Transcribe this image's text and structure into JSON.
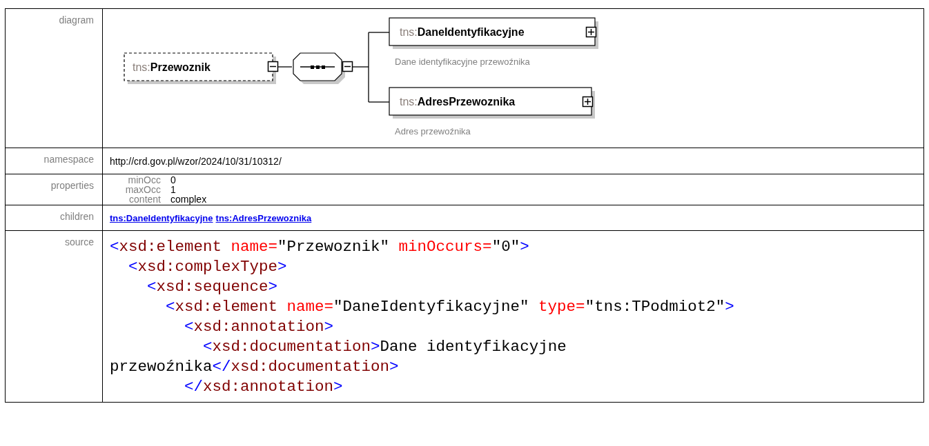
{
  "rows": [
    {
      "kind": "diagram",
      "label": "diagram",
      "diagram": {
        "root": {
          "prefix": "tns:",
          "name": "Przewoznik",
          "optional": true,
          "expanded": true
        },
        "compositor": {
          "kind": "sequence",
          "expanded": true
        },
        "children": [
          {
            "prefix": "tns:",
            "name": "DaneIdentyfikacyjne",
            "expanded": false,
            "annotation": "Dane identyfikacyjne przewoźnika"
          },
          {
            "prefix": "tns:",
            "name": "AdresPrzewoznika",
            "expanded": false,
            "annotation": "Adres przewoźnika"
          }
        ]
      }
    },
    {
      "kind": "text",
      "label": "namespace",
      "value": "http://crd.gov.pl/wzor/2024/10/31/10312/"
    },
    {
      "kind": "properties",
      "label": "properties",
      "items": [
        {
          "key": "minOcc",
          "value": "0"
        },
        {
          "key": "maxOcc",
          "value": "1"
        },
        {
          "key": "content",
          "value": "complex"
        }
      ]
    },
    {
      "kind": "links",
      "label": "children",
      "links": [
        "tns:DaneIdentyfikacyjne",
        "tns:AdresPrzewoznika"
      ]
    },
    {
      "kind": "source",
      "label": "source",
      "lines": [
        [
          {
            "kind": "tag",
            "t": "<"
          },
          {
            "kind": "element",
            "t": "xsd:element"
          },
          {
            "kind": "attribute",
            "t": " name="
          },
          {
            "kind": "text",
            "t": "\"Przewoznik\""
          },
          {
            "kind": "attribute",
            "t": " minOccurs="
          },
          {
            "kind": "text",
            "t": "\"0\""
          },
          {
            "kind": "tag",
            "t": ">"
          }
        ],
        [
          {
            "kind": "tag",
            "t": "  <"
          },
          {
            "kind": "element",
            "t": "xsd:complexType"
          },
          {
            "kind": "tag",
            "t": ">"
          }
        ],
        [
          {
            "kind": "tag",
            "t": "    <"
          },
          {
            "kind": "element",
            "t": "xsd:sequence"
          },
          {
            "kind": "tag",
            "t": ">"
          }
        ],
        [
          {
            "kind": "tag",
            "t": "      <"
          },
          {
            "kind": "element",
            "t": "xsd:element"
          },
          {
            "kind": "attribute",
            "t": " name="
          },
          {
            "kind": "text",
            "t": "\"DaneIdentyfikacyjne\""
          },
          {
            "kind": "attribute",
            "t": " type="
          },
          {
            "kind": "text",
            "t": "\"tns:TPodmiot2\""
          },
          {
            "kind": "tag",
            "t": ">"
          }
        ],
        [
          {
            "kind": "tag",
            "t": "        <"
          },
          {
            "kind": "element",
            "t": "xsd:annotation"
          },
          {
            "kind": "tag",
            "t": ">"
          }
        ],
        [
          {
            "kind": "tag",
            "t": "          <"
          },
          {
            "kind": "element",
            "t": "xsd:documentation"
          },
          {
            "kind": "tag",
            "t": ">"
          },
          {
            "kind": "text",
            "t": "Dane identyfikacyjne"
          }
        ],
        [
          {
            "kind": "text",
            "t": "przewoźnika"
          },
          {
            "kind": "tag",
            "t": "</"
          },
          {
            "kind": "element",
            "t": "xsd:documentation"
          },
          {
            "kind": "tag",
            "t": ">"
          }
        ],
        [
          {
            "kind": "tag",
            "t": "        </"
          },
          {
            "kind": "element",
            "t": "xsd:annotation"
          },
          {
            "kind": "tag",
            "t": ">"
          }
        ]
      ]
    }
  ]
}
